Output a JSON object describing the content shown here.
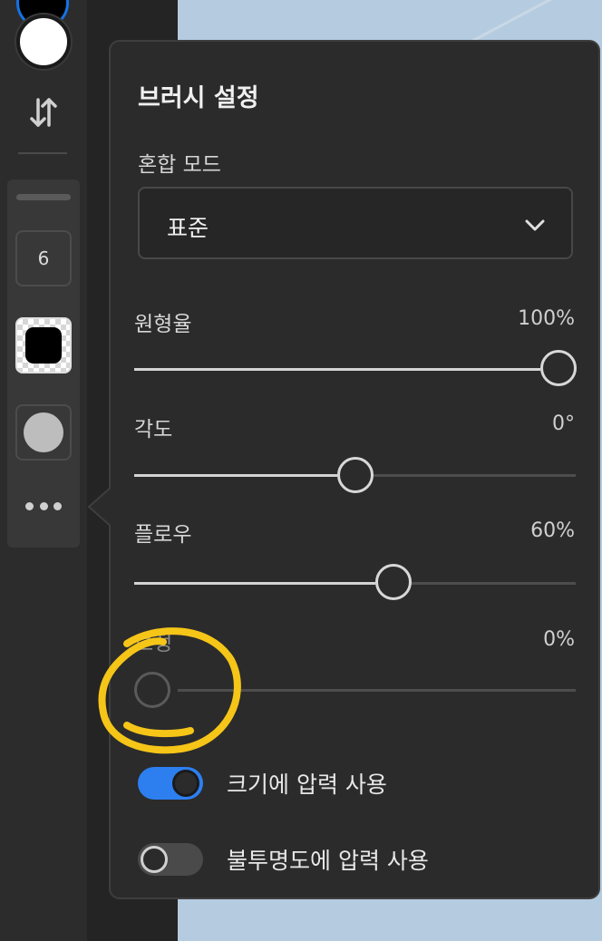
{
  "toolbar": {
    "brush_size": "6",
    "icons": [
      "swap-colors-icon",
      "more-icon"
    ]
  },
  "popover": {
    "title": "브러시 설정",
    "blend_mode": {
      "label": "혼합 모드",
      "value": "표준"
    },
    "roundness": {
      "label": "원형율",
      "value": "100%",
      "level": 1.0
    },
    "angle": {
      "label": "각도",
      "value": "0°",
      "level": 0.5
    },
    "flow": {
      "label": "플로우",
      "value": "60%",
      "level": 0.6
    },
    "smoothing": {
      "label": "보정",
      "value": "0%",
      "level": 0.0
    },
    "pressure_size": {
      "label": "크기에 압력 사용",
      "on": true
    },
    "pressure_opacity": {
      "label": "불투명도에 압력 사용",
      "on": false
    }
  },
  "colors": {
    "accent": "#2d7ff0",
    "panel": "#2b2b2b",
    "annotation": "#f5c518"
  }
}
